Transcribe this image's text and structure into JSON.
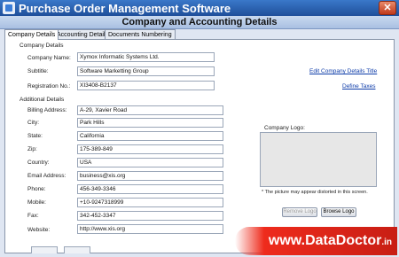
{
  "app": {
    "title": "Purchase Order Management Software",
    "close_glyph": "✕"
  },
  "window": {
    "title": "Company and Accounting Details"
  },
  "tabs": [
    "Company Details",
    "Accounting Details",
    "Documents Numbering"
  ],
  "company_group": {
    "title": "Company Details",
    "fields": [
      {
        "label": "Company Name:",
        "value": "Xymox Informatic Systems Ltd."
      },
      {
        "label": "Subtitle:",
        "value": "Software Marketting Group"
      },
      {
        "label": "Registration No.:",
        "value": "XI3408-B2137"
      }
    ],
    "edit_link": "Edit Company Details Title",
    "taxes_link": "Define Taxes"
  },
  "additional_group": {
    "title": "Additional Details",
    "fields": [
      {
        "label": "Billing Address:",
        "value": "A-29, Xavier Road"
      },
      {
        "label": "City:",
        "value": "Park Hills"
      },
      {
        "label": "State:",
        "value": "California"
      },
      {
        "label": "Zip:",
        "value": "175-389-849"
      },
      {
        "label": "Country:",
        "value": "USA"
      },
      {
        "label": "Email Address:",
        "value": "business@xis.org"
      },
      {
        "label": "Phone:",
        "value": "456-349-3346"
      },
      {
        "label": "Mobile:",
        "value": "+10-9247318999"
      },
      {
        "label": "Fax:",
        "value": "342-452-3347"
      },
      {
        "label": "Website:",
        "value": "http://www.xis.org"
      }
    ]
  },
  "logo": {
    "label": "Company Logo:",
    "note": "* The picture may appear distorted in this screen.",
    "remove_button": "Remove Logo",
    "browse_button": "Browse Logo"
  },
  "watermark": {
    "main": "www.DataDoctor",
    "tld": ".in",
    "color": "#e8281c"
  }
}
